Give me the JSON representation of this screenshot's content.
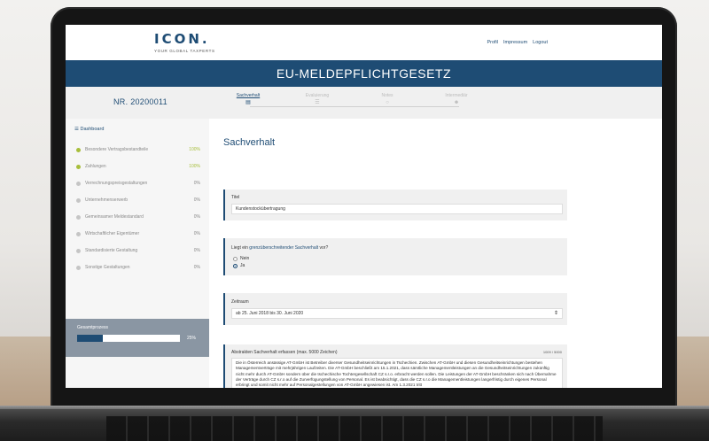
{
  "header": {
    "logo_text": "ICON.",
    "logo_tagline": "YOUR GLOBAL TAXPERTS",
    "nav": [
      "Profil",
      "Impressum",
      "Logout"
    ]
  },
  "banner_title": "EU-MELDEPFLICHTGESETZ",
  "case_number": "NR. 20200011",
  "steps": [
    {
      "label": "Sachverhalt",
      "icon": "document-icon",
      "active": true
    },
    {
      "label": "Evaluierung",
      "icon": "list-icon",
      "active": false
    },
    {
      "label": "Notes",
      "icon": "chat-icon",
      "active": false
    },
    {
      "label": "Intermediär",
      "icon": "person-icon",
      "active": false
    }
  ],
  "sidebar": {
    "dashboard_label": "Dashboard",
    "items": [
      {
        "label": "Besondere Vertragsbestandteile",
        "percent": "100%",
        "done": true
      },
      {
        "label": "Zahlungen",
        "percent": "100%",
        "done": true
      },
      {
        "label": "Verrechnungspreisgestaltungen",
        "percent": "0%",
        "done": false
      },
      {
        "label": "Unternehmenserwerb",
        "percent": "0%",
        "done": false
      },
      {
        "label": "Gemeinsamer Meldestandard",
        "percent": "0%",
        "done": false
      },
      {
        "label": "Wirtschaftlicher Eigentümer",
        "percent": "0%",
        "done": false
      },
      {
        "label": "Standardisierte Gestaltung",
        "percent": "0%",
        "done": false
      },
      {
        "label": "Sonstige Gestaltungen",
        "percent": "0%",
        "done": false
      }
    ],
    "overall_label": "Gesamtprozess",
    "overall_value": "25%",
    "overall_fraction": 0.25
  },
  "main": {
    "title": "Sachverhalt",
    "titel_label": "Titel",
    "titel_value": "Kundenstockübertragung",
    "question_prefix": "Liegt ein ",
    "question_link": "grenzüberschreitender Sachverhalt",
    "question_suffix": " vor?",
    "radio_options": [
      {
        "label": "Nein",
        "checked": false
      },
      {
        "label": "Ja",
        "checked": true
      }
    ],
    "zeitraum_label": "Zeitraum",
    "zeitraum_value": "ab 25. Juni 2018 bis 30. Juni 2020",
    "abstract_label": "Abstrakten Sachverhalt erfassen (max. 5000 Zeichen)",
    "abstract_counter": "1009 / 5000",
    "abstract_text": "Die in Österreich ansässige AT-GmbH ist Betreiber diverser Gesundheitseinrichtungen in Tschechien. Zwischen AT-GmbH und diesen Gesundheitseinrichtungen bestehen Managementverträge mit mehrjährigen Laufzeiten. Die AT-GmbH beschließt am 15.1.2021, dass sämtliche Managementleistungen an die Gesundheitseinrichtungen zukünftig nicht mehr durch AT-GmbH sondern über die tschechische Tochtergesellschaft CZ s.r.o. erbracht werden sollen. Die Leistungen der AT-GmbH beschränken sich nach Übernahme der Verträge durch CZ s.r.o auf die Zurverfügungstellung von Personal. Es ist beabsichtigt, dass die CZ s.r.o die Managementleistungen langerfristig durch eigenes Personal erbringt und somit nicht mehr auf Personalgestellungen von AT-GmbH angewiesen ist. Am 1.3.2021 tritt"
  }
}
